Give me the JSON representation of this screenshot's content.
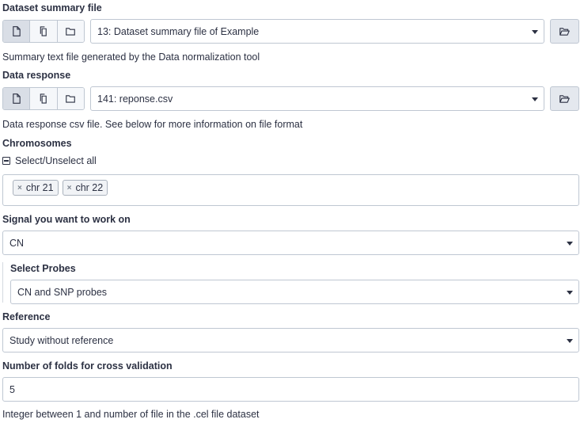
{
  "dataset_summary": {
    "label": "Dataset summary file",
    "selected": "13: Dataset summary file of Example",
    "help": "Summary text file generated by the Data normalization tool"
  },
  "data_response": {
    "label": "Data response",
    "selected": "141: reponse.csv",
    "help": "Data response csv file. See below for more information on file format"
  },
  "chromosomes": {
    "label": "Chromosomes",
    "select_all": "Select/Unselect all",
    "tags": [
      "chr 21",
      "chr 22"
    ],
    "remove_glyph": "×"
  },
  "signal": {
    "label": "Signal you want to work on",
    "selected": "CN"
  },
  "probes": {
    "label": "Select Probes",
    "selected": "CN and SNP probes"
  },
  "reference": {
    "label": "Reference",
    "selected": "Study without reference"
  },
  "folds": {
    "label": "Number of folds for cross validation",
    "value": "5",
    "help": "Integer between 1 and number of file in the .cel file dataset"
  },
  "icons": {
    "single_file": "file-icon",
    "multi_file": "copy-icon",
    "collection": "folder-icon",
    "browse": "folder-open-icon"
  },
  "colors": {
    "border": "#bfc7d2",
    "active_button": "#d9dee6",
    "text": "#2c3143"
  }
}
